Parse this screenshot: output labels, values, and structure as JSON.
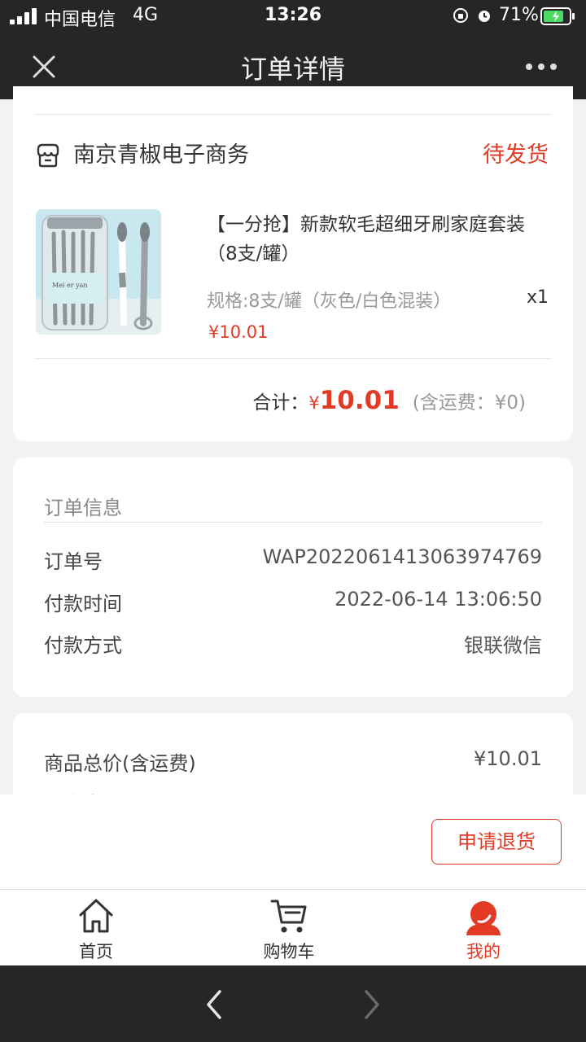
{
  "status_bar": {
    "carrier": "中国电信",
    "network": "4G",
    "time": "13:26",
    "battery": "71%"
  },
  "header": {
    "title": "订单详情",
    "close_icon": "close-icon",
    "more_icon": "more-icon"
  },
  "store": {
    "name": "南京青椒电子商务",
    "status": "待发货",
    "icon": "store-icon"
  },
  "product": {
    "title": "【一分抢】新款软毛超细牙刷家庭套装（8支/罐）",
    "spec": "规格:8支/罐（灰色/白色混装）",
    "qty": "x1",
    "price": "¥10.01",
    "image_text": "Mei er yan"
  },
  "total": {
    "label": "合计：",
    "currency": "¥",
    "amount": "10.01",
    "shipping": "(含运费：¥0)"
  },
  "order_info": {
    "title": "订单信息",
    "rows": [
      {
        "label": "订单号",
        "value": "WAP2022061413063974769"
      },
      {
        "label": "付款时间",
        "value": "2022-06-14 13:06:50"
      },
      {
        "label": "付款方式",
        "value": "银联微信"
      }
    ]
  },
  "price_detail": {
    "goods_total_label": "商品总价(含运费)",
    "goods_total_value": "¥10.01",
    "partial_label": "优惠券"
  },
  "actions": {
    "refund": "申请退货"
  },
  "tabs": [
    {
      "label": "首页",
      "icon": "home-icon",
      "active": false
    },
    {
      "label": "购物车",
      "icon": "cart-icon",
      "active": false
    },
    {
      "label": "我的",
      "icon": "user-icon",
      "active": true
    }
  ],
  "colors": {
    "accent": "#e23a24",
    "dark_bar": "#262626",
    "background": "#f2f2f2"
  }
}
